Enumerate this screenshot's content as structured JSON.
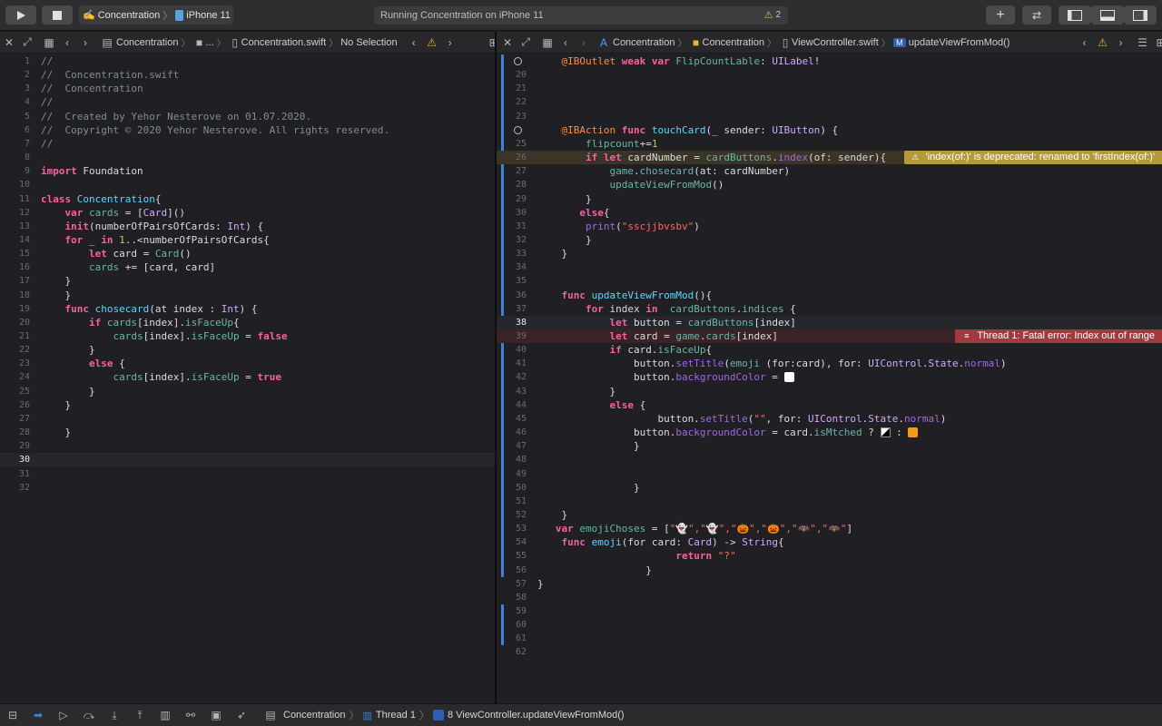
{
  "toolbar": {
    "scheme_app": "Concentration",
    "scheme_device": "iPhone 11",
    "status_text": "Running Concentration on iPhone 11",
    "warning_count": "2"
  },
  "left_jumpbar": {
    "crumbs": [
      "Concentration",
      "...",
      "Concentration.swift",
      "No Selection"
    ]
  },
  "right_jumpbar": {
    "crumbs": [
      "Concentration",
      "Concentration",
      "ViewController.swift",
      "updateViewFromMod()"
    ]
  },
  "issues": {
    "warning": "'index(of:)' is deprecated: renamed to 'firstIndex(of:)'",
    "error": "Thread 1: Fatal error: Index out of range"
  },
  "debugbar": {
    "crumbs": [
      "Concentration",
      "Thread 1",
      "8 ViewController.updateViewFromMod()"
    ]
  },
  "colors": {
    "accent": "#3f83d9",
    "keyword": "#fc5fa3",
    "comment": "#7f8c98",
    "warning": "#b49a3c",
    "error": "#a13a3f"
  },
  "left_code": [
    {
      "n": "1",
      "t": [
        [
          "cm",
          "//"
        ]
      ]
    },
    {
      "n": "2",
      "t": [
        [
          "cm",
          "//  Concentration.swift"
        ]
      ]
    },
    {
      "n": "3",
      "t": [
        [
          "cm",
          "//  Concentration"
        ]
      ]
    },
    {
      "n": "4",
      "t": [
        [
          "cm",
          "//"
        ]
      ]
    },
    {
      "n": "5",
      "t": [
        [
          "cm",
          "//  Created by Yehor Nesterove on 01.07.2020."
        ]
      ]
    },
    {
      "n": "6",
      "t": [
        [
          "cm",
          "//  Copyright © 2020 Yehor Nesterove. All rights reserved."
        ]
      ]
    },
    {
      "n": "7",
      "t": [
        [
          "cm",
          "//"
        ]
      ]
    },
    {
      "n": "8",
      "t": []
    },
    {
      "n": "9",
      "t": [
        [
          "kw",
          "import"
        ],
        [
          "pl",
          " Foundation"
        ]
      ]
    },
    {
      "n": "10",
      "t": []
    },
    {
      "n": "11",
      "t": [
        [
          "kw",
          "class"
        ],
        [
          "pl",
          " "
        ],
        [
          "cl",
          "Concentration"
        ],
        [
          "pl",
          "{"
        ]
      ]
    },
    {
      "n": "12",
      "t": [
        [
          "pl",
          "    "
        ],
        [
          "kw",
          "var"
        ],
        [
          "pl",
          " "
        ],
        [
          "fn",
          "cards"
        ],
        [
          "pl",
          " = ["
        ],
        [
          "ty",
          "Card"
        ],
        [
          "pl",
          "]()"
        ]
      ]
    },
    {
      "n": "13",
      "t": [
        [
          "pl",
          "    "
        ],
        [
          "kw",
          "init"
        ],
        [
          "pl",
          "(numberOfPairsOfCards: "
        ],
        [
          "ty",
          "Int"
        ],
        [
          "pl",
          ") {"
        ]
      ]
    },
    {
      "n": "14",
      "t": [
        [
          "pl",
          "    "
        ],
        [
          "kw",
          "for"
        ],
        [
          "pl",
          " _ "
        ],
        [
          "kw",
          "in"
        ],
        [
          "pl",
          " "
        ],
        [
          "nm",
          "1"
        ],
        [
          "pl",
          "..<numberOfPairsOfCards{"
        ]
      ]
    },
    {
      "n": "15",
      "t": [
        [
          "pl",
          "        "
        ],
        [
          "kw",
          "let"
        ],
        [
          "pl",
          " card = "
        ],
        [
          "fn",
          "Card"
        ],
        [
          "pl",
          "()"
        ]
      ]
    },
    {
      "n": "16",
      "t": [
        [
          "pl",
          "        "
        ],
        [
          "fn",
          "cards"
        ],
        [
          "pl",
          " += [card, card]"
        ]
      ]
    },
    {
      "n": "17",
      "t": [
        [
          "pl",
          "    }"
        ]
      ]
    },
    {
      "n": "18",
      "t": [
        [
          "pl",
          "    }"
        ]
      ]
    },
    {
      "n": "19",
      "t": [
        [
          "pl",
          "    "
        ],
        [
          "kw",
          "func"
        ],
        [
          "pl",
          " "
        ],
        [
          "cl",
          "chosecard"
        ],
        [
          "pl",
          "(at index : "
        ],
        [
          "ty",
          "Int"
        ],
        [
          "pl",
          ") {"
        ]
      ]
    },
    {
      "n": "20",
      "t": [
        [
          "pl",
          "        "
        ],
        [
          "kw",
          "if"
        ],
        [
          "pl",
          " "
        ],
        [
          "fn",
          "cards"
        ],
        [
          "pl",
          "[index]."
        ],
        [
          "fn",
          "isFaceUp"
        ],
        [
          "pl",
          "{"
        ]
      ]
    },
    {
      "n": "21",
      "t": [
        [
          "pl",
          "            "
        ],
        [
          "fn",
          "cards"
        ],
        [
          "pl",
          "[index]."
        ],
        [
          "fn",
          "isFaceUp"
        ],
        [
          "pl",
          " = "
        ],
        [
          "kw",
          "false"
        ]
      ]
    },
    {
      "n": "22",
      "t": [
        [
          "pl",
          "        }"
        ]
      ]
    },
    {
      "n": "23",
      "t": [
        [
          "pl",
          "        "
        ],
        [
          "kw",
          "else"
        ],
        [
          "pl",
          " {"
        ]
      ]
    },
    {
      "n": "24",
      "t": [
        [
          "pl",
          "            "
        ],
        [
          "fn",
          "cards"
        ],
        [
          "pl",
          "[index]."
        ],
        [
          "fn",
          "isFaceUp"
        ],
        [
          "pl",
          " = "
        ],
        [
          "kw",
          "true"
        ]
      ]
    },
    {
      "n": "25",
      "t": [
        [
          "pl",
          "        }"
        ]
      ]
    },
    {
      "n": "26",
      "t": [
        [
          "pl",
          "    }"
        ]
      ]
    },
    {
      "n": "27",
      "t": []
    },
    {
      "n": "28",
      "t": [
        [
          "pl",
          "    }"
        ]
      ]
    },
    {
      "n": "29",
      "t": []
    },
    {
      "n": "30",
      "t": [],
      "cur": true
    },
    {
      "n": "31",
      "t": []
    },
    {
      "n": "32",
      "t": []
    }
  ],
  "right_code": [
    {
      "n": "",
      "t": [
        [
          "pl",
          "    "
        ],
        [
          "at",
          "@IBOutlet"
        ],
        [
          "pl",
          " "
        ],
        [
          "kw",
          "weak"
        ],
        [
          "pl",
          " "
        ],
        [
          "kw",
          "var"
        ],
        [
          "pl",
          " "
        ],
        [
          "fn",
          "FlipCountLable"
        ],
        [
          "pl",
          ": "
        ],
        [
          "ty",
          "UILabel"
        ],
        [
          "pl",
          "!"
        ]
      ],
      "circle": true
    },
    {
      "n": "20",
      "t": []
    },
    {
      "n": "21",
      "t": []
    },
    {
      "n": "22",
      "t": []
    },
    {
      "n": "23",
      "t": []
    },
    {
      "n": "",
      "t": [
        [
          "pl",
          "    "
        ],
        [
          "at",
          "@IBAction"
        ],
        [
          "pl",
          " "
        ],
        [
          "kw",
          "func"
        ],
        [
          "pl",
          " "
        ],
        [
          "cl",
          "touchCard"
        ],
        [
          "pl",
          "(_ sender: "
        ],
        [
          "ty",
          "UIButton"
        ],
        [
          "pl",
          ") {"
        ]
      ],
      "circle": true
    },
    {
      "n": "25",
      "t": [
        [
          "pl",
          "        "
        ],
        [
          "fn",
          "flipcount"
        ],
        [
          "pl",
          "+="
        ],
        [
          "nm",
          "1"
        ]
      ]
    },
    {
      "n": "26",
      "t": [
        [
          "pl",
          "        "
        ],
        [
          "kw",
          "if"
        ],
        [
          "pl",
          " "
        ],
        [
          "kw",
          "let"
        ],
        [
          "pl",
          " cardNumber = "
        ],
        [
          "fn",
          "cardButtons"
        ],
        [
          "pl",
          "."
        ],
        [
          "pr",
          "index"
        ],
        [
          "pl",
          "(of: sender){"
        ]
      ],
      "warn": true
    },
    {
      "n": "27",
      "t": [
        [
          "pl",
          "            "
        ],
        [
          "fn",
          "game"
        ],
        [
          "pl",
          "."
        ],
        [
          "fn",
          "chosecard"
        ],
        [
          "pl",
          "(at: cardNumber)"
        ]
      ]
    },
    {
      "n": "28",
      "t": [
        [
          "pl",
          "            "
        ],
        [
          "fn",
          "updateViewFromMod"
        ],
        [
          "pl",
          "()"
        ]
      ]
    },
    {
      "n": "29",
      "t": [
        [
          "pl",
          "        }"
        ]
      ]
    },
    {
      "n": "30",
      "t": [
        [
          "pl",
          "       "
        ],
        [
          "kw",
          "else"
        ],
        [
          "pl",
          "{"
        ]
      ]
    },
    {
      "n": "31",
      "t": [
        [
          "pl",
          "        "
        ],
        [
          "pr",
          "print"
        ],
        [
          "pl",
          "("
        ],
        [
          "st",
          "\"sscjjbvsbv\""
        ],
        [
          "pl",
          ")"
        ]
      ]
    },
    {
      "n": "32",
      "t": [
        [
          "pl",
          "        }"
        ]
      ]
    },
    {
      "n": "33",
      "t": [
        [
          "pl",
          "    }"
        ]
      ]
    },
    {
      "n": "34",
      "t": []
    },
    {
      "n": "35",
      "t": []
    },
    {
      "n": "36",
      "t": [
        [
          "pl",
          "    "
        ],
        [
          "kw",
          "func"
        ],
        [
          "pl",
          " "
        ],
        [
          "cl",
          "updateViewFromMod"
        ],
        [
          "pl",
          "(){"
        ]
      ]
    },
    {
      "n": "37",
      "t": [
        [
          "pl",
          "        "
        ],
        [
          "kw",
          "for"
        ],
        [
          "pl",
          " index "
        ],
        [
          "kw",
          "in"
        ],
        [
          "pl",
          "  "
        ],
        [
          "fn",
          "cardButtons"
        ],
        [
          "pl",
          "."
        ],
        [
          "fn",
          "indices"
        ],
        [
          "pl",
          " {"
        ]
      ]
    },
    {
      "n": "38",
      "t": [
        [
          "pl",
          "            "
        ],
        [
          "kw",
          "let"
        ],
        [
          "pl",
          " button = "
        ],
        [
          "fn",
          "cardButtons"
        ],
        [
          "pl",
          "[index]"
        ]
      ],
      "cur": true
    },
    {
      "n": "39",
      "t": [
        [
          "pl",
          "            "
        ],
        [
          "kw",
          "let"
        ],
        [
          "pl",
          " card = "
        ],
        [
          "fn",
          "game"
        ],
        [
          "pl",
          "."
        ],
        [
          "fn",
          "cards"
        ],
        [
          "pl",
          "[index]"
        ]
      ],
      "err": true
    },
    {
      "n": "40",
      "t": [
        [
          "pl",
          "            "
        ],
        [
          "kw",
          "if"
        ],
        [
          "pl",
          " card."
        ],
        [
          "fn",
          "isFaceUp"
        ],
        [
          "pl",
          "{"
        ]
      ]
    },
    {
      "n": "41",
      "t": [
        [
          "pl",
          "                button."
        ],
        [
          "pr",
          "setTitle"
        ],
        [
          "pl",
          "("
        ],
        [
          "fn",
          "emoji"
        ],
        [
          "pl",
          " (for:card), for: "
        ],
        [
          "ty",
          "UIControl"
        ],
        [
          "pl",
          "."
        ],
        [
          "ty",
          "State"
        ],
        [
          "pl",
          "."
        ],
        [
          "pr",
          "normal"
        ],
        [
          "pl",
          ")"
        ]
      ]
    },
    {
      "n": "42",
      "t": [
        [
          "pl",
          "                button."
        ],
        [
          "pr",
          "backgroundColor"
        ],
        [
          "pl",
          " = "
        ]
      ],
      "swatch": "white"
    },
    {
      "n": "43",
      "t": [
        [
          "pl",
          "            }"
        ]
      ]
    },
    {
      "n": "44",
      "t": [
        [
          "pl",
          "            "
        ],
        [
          "kw",
          "else"
        ],
        [
          "pl",
          " {"
        ]
      ]
    },
    {
      "n": "45",
      "t": [
        [
          "pl",
          "                    button."
        ],
        [
          "pr",
          "setTitle"
        ],
        [
          "pl",
          "("
        ],
        [
          "st",
          "\"\""
        ],
        [
          "pl",
          ", for: "
        ],
        [
          "ty",
          "UIControl"
        ],
        [
          "pl",
          "."
        ],
        [
          "ty",
          "State"
        ],
        [
          "pl",
          "."
        ],
        [
          "pr",
          "normal"
        ],
        [
          "pl",
          ")"
        ]
      ]
    },
    {
      "n": "46",
      "t": [
        [
          "pl",
          "                button."
        ],
        [
          "pr",
          "backgroundColor"
        ],
        [
          "pl",
          " = card."
        ],
        [
          "fn",
          "isMtched"
        ],
        [
          "pl",
          " ? "
        ]
      ],
      "swatch": "pair"
    },
    {
      "n": "47",
      "t": [
        [
          "pl",
          "                }"
        ]
      ]
    },
    {
      "n": "48",
      "t": []
    },
    {
      "n": "49",
      "t": []
    },
    {
      "n": "50",
      "t": [
        [
          "pl",
          "                }"
        ]
      ]
    },
    {
      "n": "51",
      "t": []
    },
    {
      "n": "52",
      "t": [
        [
          "pl",
          "    }"
        ]
      ]
    },
    {
      "n": "53",
      "t": [
        [
          "pl",
          "   "
        ],
        [
          "kw",
          "var"
        ],
        [
          "pl",
          " "
        ],
        [
          "fn",
          "emojiChoses"
        ],
        [
          "pl",
          " = ["
        ],
        [
          "st",
          "\"👻\",\"👻\",\"🎃\",\"🎃\",\"🦇\",\"🦇\""
        ],
        [
          "pl",
          "]"
        ]
      ]
    },
    {
      "n": "54",
      "t": [
        [
          "pl",
          "    "
        ],
        [
          "kw",
          "func"
        ],
        [
          "pl",
          " "
        ],
        [
          "cl",
          "emoji"
        ],
        [
          "pl",
          "(for card: "
        ],
        [
          "ty",
          "Card"
        ],
        [
          "pl",
          ") -> "
        ],
        [
          "ty",
          "String"
        ],
        [
          "pl",
          "{"
        ]
      ]
    },
    {
      "n": "55",
      "t": [
        [
          "pl",
          "                       "
        ],
        [
          "kw",
          "return"
        ],
        [
          "pl",
          " "
        ],
        [
          "st",
          "\"?\""
        ]
      ]
    },
    {
      "n": "56",
      "t": [
        [
          "pl",
          "                  }"
        ]
      ]
    },
    {
      "n": "57",
      "t": [
        [
          "pl",
          "}"
        ]
      ]
    },
    {
      "n": "58",
      "t": []
    },
    {
      "n": "59",
      "t": []
    },
    {
      "n": "60",
      "t": []
    },
    {
      "n": "61",
      "t": []
    },
    {
      "n": "62",
      "t": []
    }
  ]
}
